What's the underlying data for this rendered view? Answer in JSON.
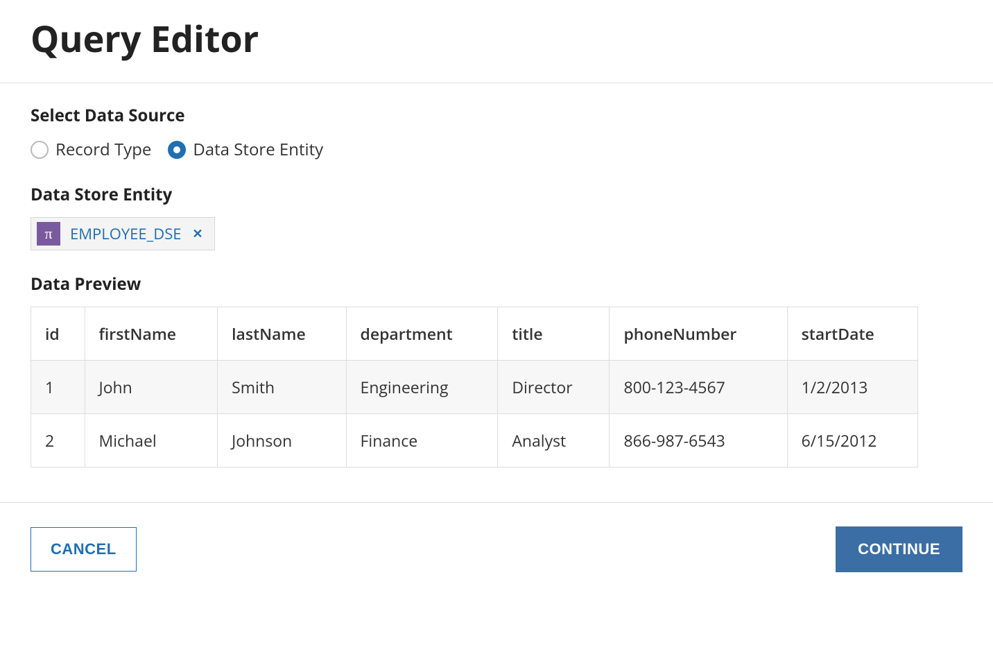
{
  "header": {
    "title": "Query Editor"
  },
  "dataSource": {
    "label": "Select Data Source",
    "options": {
      "recordType": "Record Type",
      "dataStoreEntity": "Data Store Entity"
    }
  },
  "entity": {
    "label": "Data Store Entity",
    "iconGlyph": "π",
    "name": "EMPLOYEE_DSE",
    "removeGlyph": "✕"
  },
  "preview": {
    "label": "Data Preview",
    "columns": [
      "id",
      "firstName",
      "lastName",
      "department",
      "title",
      "phoneNumber",
      "startDate"
    ],
    "rows": [
      {
        "id": "1",
        "firstName": "John",
        "lastName": "Smith",
        "department": "Engineering",
        "title": "Director",
        "phoneNumber": "800-123-4567",
        "startDate": "1/2/2013"
      },
      {
        "id": "2",
        "firstName": "Michael",
        "lastName": "Johnson",
        "department": "Finance",
        "title": "Analyst",
        "phoneNumber": "866-987-6543",
        "startDate": "6/15/2012"
      }
    ]
  },
  "footer": {
    "cancel": "CANCEL",
    "continue": "CONTINUE"
  }
}
